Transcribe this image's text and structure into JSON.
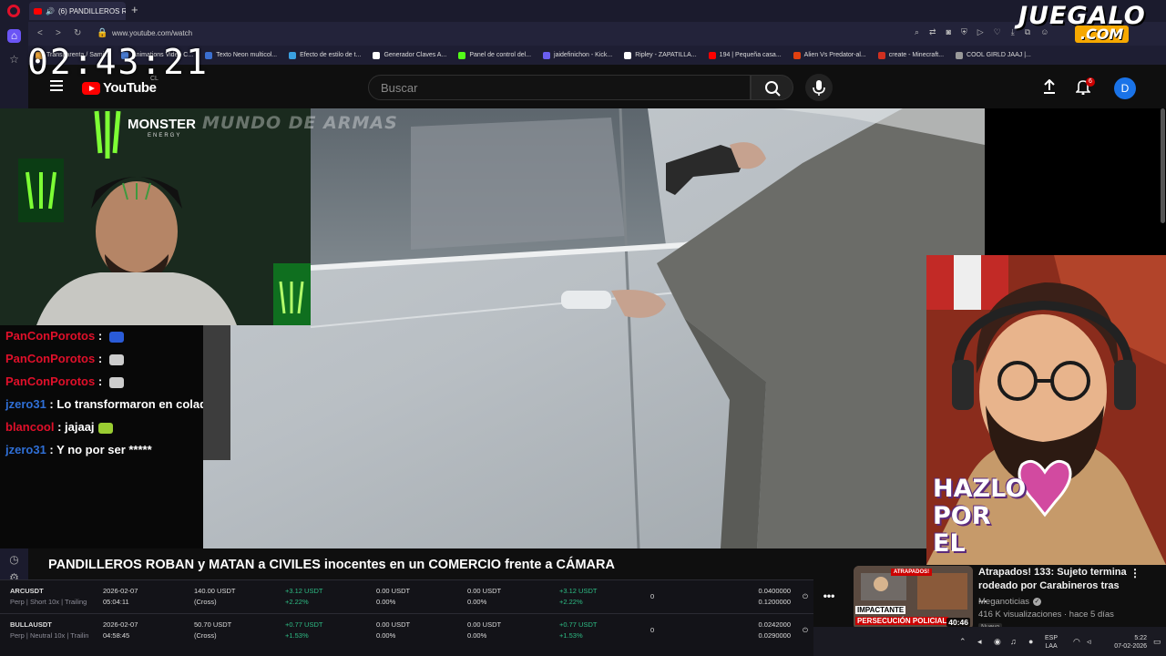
{
  "browser": {
    "tab_title": "(6) PANDILLEROS ROB",
    "url": "www.youtube.com/watch",
    "bookmarks": [
      "Transparenta / Sami...",
      "Animations Video C...",
      "Texto Neon multicol...",
      "Efecto de estilo de t...",
      "Generador Claves A...",
      "Panel de control del...",
      "jaidefinichon - Kick...",
      "Ripley - ZAPATILLA...",
      "194 | Pequeña casa...",
      "Alien Vs Predator-al...",
      "create - Minecraft...",
      "COOL GIRLD JAAJ |..."
    ],
    "bookmark_colors": [
      "#e6a23c",
      "#4a7bd0",
      "#3b6fd0",
      "#3aa0e0",
      "#ffffff",
      "#53fc18",
      "#6b5ff0",
      "#ffffff",
      "#ff0000",
      "#e04010",
      "#d03020",
      "#999999"
    ]
  },
  "overlay": {
    "clock": "02:43:21",
    "logo_main": "JUEGALO",
    "logo_sub": ".COM",
    "watermark": "MUNDO DE ARMAS",
    "monster_brand": "MONSTER",
    "monster_sub": "ENERGY",
    "hazlo_lines": [
      "HAZLO",
      "POR",
      "EL"
    ]
  },
  "youtube": {
    "logo_text": "YouTube",
    "country_code": "CL",
    "search_placeholder": "Buscar",
    "notification_count": "6",
    "avatar_letter": "D",
    "video_title": "PANDILLEROS ROBAN y MATAN a CIVILES inocentes en un COMERCIO frente a CÁMARA"
  },
  "chat": [
    {
      "user": "PanConPorotos",
      "message": "",
      "user_color": "red",
      "emote_color": "#2a5bd7"
    },
    {
      "user": "PanConPorotos",
      "message": "",
      "user_color": "red",
      "emote_color": "#cccccc"
    },
    {
      "user": "PanConPorotos",
      "message": "",
      "user_color": "red",
      "emote_color": "#cccccc"
    },
    {
      "user": "jzero31",
      "message": "Lo transformaron en colador",
      "user_color": "blue",
      "emote_color": ""
    },
    {
      "user": "blancool",
      "message": "jajaaj",
      "user_color": "red",
      "emote_color": "#9acd32"
    },
    {
      "user": "jzero31",
      "message": "Y no por ser *****",
      "user_color": "blue",
      "emote_color": ""
    }
  ],
  "trades": [
    {
      "symbol": "ARCUSDT",
      "details": "Perp | Short 10x | Trailing",
      "date": "2026-02-07",
      "time": "05:04:11",
      "margin": "140.00 USDT",
      "margin_mode": "(Cross)",
      "pnl": "+3.12 USDT",
      "pnl_pct": "+2.22%",
      "fee": "0.00 USDT",
      "fee_pct": "0.00%",
      "funding": "0.00 USDT",
      "funding_pct": "0.00%",
      "total": "+3.12 USDT",
      "total_pct": "+2.22%",
      "count": "0",
      "price_a": "0.0400000",
      "price_b": "0.1200000"
    },
    {
      "symbol": "BULLAUSDT",
      "details": "Perp | Neutral 10x | Trailin",
      "date": "2026-02-07",
      "time": "04:58:45",
      "margin": "50.70 USDT",
      "margin_mode": "(Cross)",
      "pnl": "+0.77 USDT",
      "pnl_pct": "+1.53%",
      "fee": "0.00 USDT",
      "fee_pct": "0.00%",
      "funding": "0.00 USDT",
      "funding_pct": "0.00%",
      "total": "+0.77 USDT",
      "total_pct": "+1.53%",
      "count": "0",
      "price_a": "0.0242000",
      "price_b": "0.0290000"
    }
  ],
  "recommended": {
    "title": "Atrapados! 133: Sujeto termina rodeado por Carabineros tras ...",
    "channel": "Meganoticias",
    "meta": "416 K visualizaciones · hace 5 días",
    "duration": "40:46",
    "badge_top": "ATRAPADOS!",
    "badge_1": "IMPACTANTE",
    "badge_2": "PERSECUCIÓN POLICIAL",
    "new_label": "Nuevo"
  },
  "taskbar": {
    "lang_1": "ESP",
    "lang_2": "LAA",
    "time": "5:22",
    "date": "07-02-2026"
  }
}
